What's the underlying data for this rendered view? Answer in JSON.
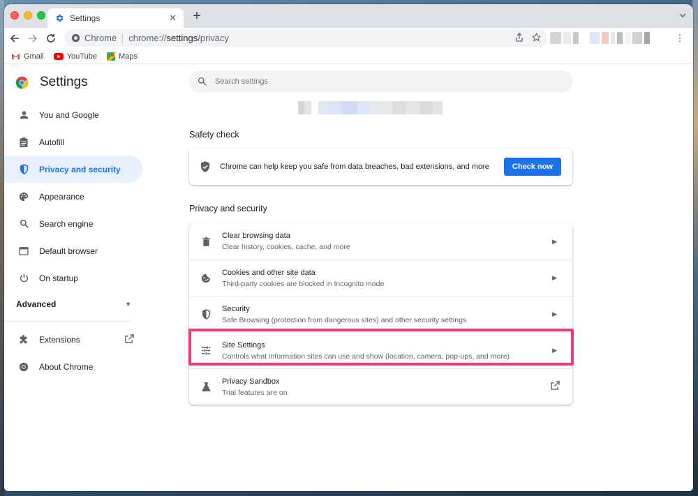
{
  "tab": {
    "title": "Settings",
    "close": "✕",
    "new_tab": "+"
  },
  "omnibox": {
    "site": "Chrome",
    "url_prefix": "chrome://",
    "url_main": "settings",
    "url_suffix": "/privacy"
  },
  "bookmarks": [
    {
      "label": "Gmail",
      "icon": "gmail-icon"
    },
    {
      "label": "YouTube",
      "icon": "youtube-icon"
    },
    {
      "label": "Maps",
      "icon": "maps-icon"
    }
  ],
  "settings": {
    "title": "Settings",
    "search_placeholder": "Search settings",
    "sidebar": {
      "items": [
        {
          "label": "You and Google",
          "icon": "person-icon"
        },
        {
          "label": "Autofill",
          "icon": "clipboard-icon"
        },
        {
          "label": "Privacy and security",
          "icon": "shield-icon",
          "active": true
        },
        {
          "label": "Appearance",
          "icon": "palette-icon"
        },
        {
          "label": "Search engine",
          "icon": "search-icon"
        },
        {
          "label": "Default browser",
          "icon": "browser-icon"
        },
        {
          "label": "On startup",
          "icon": "power-icon"
        }
      ],
      "advanced": "Advanced",
      "bottom": [
        {
          "label": "Extensions",
          "icon": "puzzle-icon"
        },
        {
          "label": "About Chrome",
          "icon": "chrome-icon"
        }
      ]
    },
    "safety_check": {
      "heading": "Safety check",
      "text": "Chrome can help keep you safe from data breaches, bad extensions, and more",
      "button": "Check now"
    },
    "privacy": {
      "heading": "Privacy and security",
      "rows": [
        {
          "title": "Clear browsing data",
          "subtitle": "Clear history, cookies, cache, and more",
          "icon": "trash-icon"
        },
        {
          "title": "Cookies and other site data",
          "subtitle": "Third-party cookies are blocked in Incognito mode",
          "icon": "cookie-icon"
        },
        {
          "title": "Security",
          "subtitle": "Safe Browsing (protection from dangerous sites) and other security settings",
          "icon": "shield-icon"
        },
        {
          "title": "Site Settings",
          "subtitle": "Controls what information sites can use and show (location, camera, pop-ups, and more)",
          "icon": "tune-icon",
          "highlighted": true
        },
        {
          "title": "Privacy Sandbox",
          "subtitle": "Trial features are on",
          "icon": "flask-icon"
        }
      ]
    }
  },
  "colors": {
    "accent": "#1a73e8",
    "highlight": "#f2397a",
    "active_bg": "#e8f0fe"
  }
}
